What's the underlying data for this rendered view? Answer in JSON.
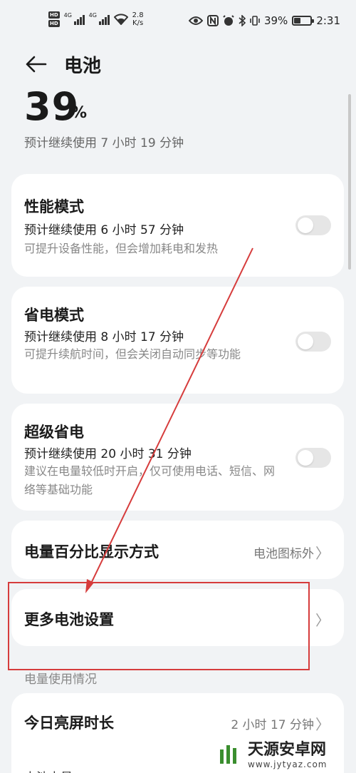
{
  "status_bar": {
    "hd1": "HD",
    "hd2": "HD",
    "net1": "4G",
    "net2": "4G",
    "speed_value": "2.8",
    "speed_unit": "K/s",
    "battery_pct": "39%",
    "time": "2:31",
    "battery_level": 0.39
  },
  "header": {
    "title": "电池",
    "percent": "39",
    "percent_sign": "%",
    "estimate": "预计继续使用 7 小时 19 分钟"
  },
  "modes": [
    {
      "title": "性能模式",
      "estimate": "预计继续使用 6 小时 57 分钟",
      "desc": "可提升设备性能，但会增加耗电和发热",
      "enabled": false
    },
    {
      "title": "省电模式",
      "estimate": "预计继续使用 8 小时 17 分钟",
      "desc": "可提升续航时间，但会关闭自动同步等功能",
      "enabled": false
    },
    {
      "title": "超级省电",
      "estimate": "预计继续使用 20 小时 31 分钟",
      "desc": "建议在电量较低时开启，仅可使用电话、短信、网络等基础功能",
      "enabled": false
    }
  ],
  "display_mode": {
    "label": "电量百分比显示方式",
    "value": "电池图标外"
  },
  "more_settings": {
    "label": "更多电池设置"
  },
  "usage": {
    "section_title": "电量使用情况",
    "screen_time_label": "今日亮屏时长",
    "screen_time_value": "2 小时 17 分钟",
    "partial_label": "电池电量"
  },
  "watermark": {
    "name": "天源安卓网",
    "url": "www.jytyaz.com"
  },
  "colors": {
    "background": "#f1f3f5",
    "card": "#ffffff",
    "annotation": "#d63c3c",
    "toggle_off": "#e6e6e6"
  }
}
